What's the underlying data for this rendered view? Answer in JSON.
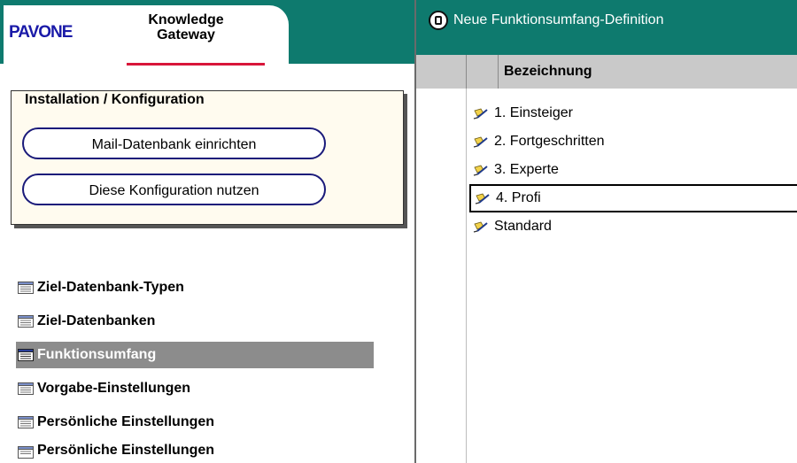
{
  "left": {
    "logo": {
      "brand": "PAVONE",
      "product_line1": "Knowledge",
      "product_line2": "Gateway"
    },
    "installation": {
      "title": "Installation / Konfiguration",
      "buttons": [
        {
          "label": "Mail-Datenbank einrichten"
        },
        {
          "label": "Diese Konfiguration nutzen"
        }
      ]
    },
    "nav": [
      {
        "label": "Ziel-Datenbank-Typen",
        "icon": "view-icon",
        "active": false
      },
      {
        "label": "Ziel-Datenbanken",
        "icon": "view-icon",
        "active": false
      },
      {
        "label": "Funktionsumfang",
        "icon": "view-icon",
        "active": true
      },
      {
        "label": "Vorgabe-Einstellungen",
        "icon": "view-icon",
        "active": false
      },
      {
        "label": "Persönliche Einstellungen",
        "icon": "view-icon",
        "active": false
      },
      {
        "label": "Persönliche Einstellungen",
        "icon": "view-icon",
        "active": false
      }
    ]
  },
  "right": {
    "action": {
      "label": "Neue Funktionsumfang-Definition",
      "icon": "new-document-icon"
    },
    "column_header": "Bezeichnung",
    "rows": [
      {
        "label": "1. Einsteiger",
        "icon": "document-pen-icon"
      },
      {
        "label": "2. Fortgeschritten",
        "icon": "document-pen-icon"
      },
      {
        "label": "3. Experte",
        "icon": "document-pen-icon"
      },
      {
        "label": "4. Profi",
        "icon": "document-pen-icon",
        "selected": true
      },
      {
        "label": "Standard",
        "icon": "document-pen-icon"
      }
    ]
  },
  "colors": {
    "header_teal": "#0e7a6e",
    "active_nav": "#8c8c8c",
    "brand_accent": "#d8163a"
  }
}
